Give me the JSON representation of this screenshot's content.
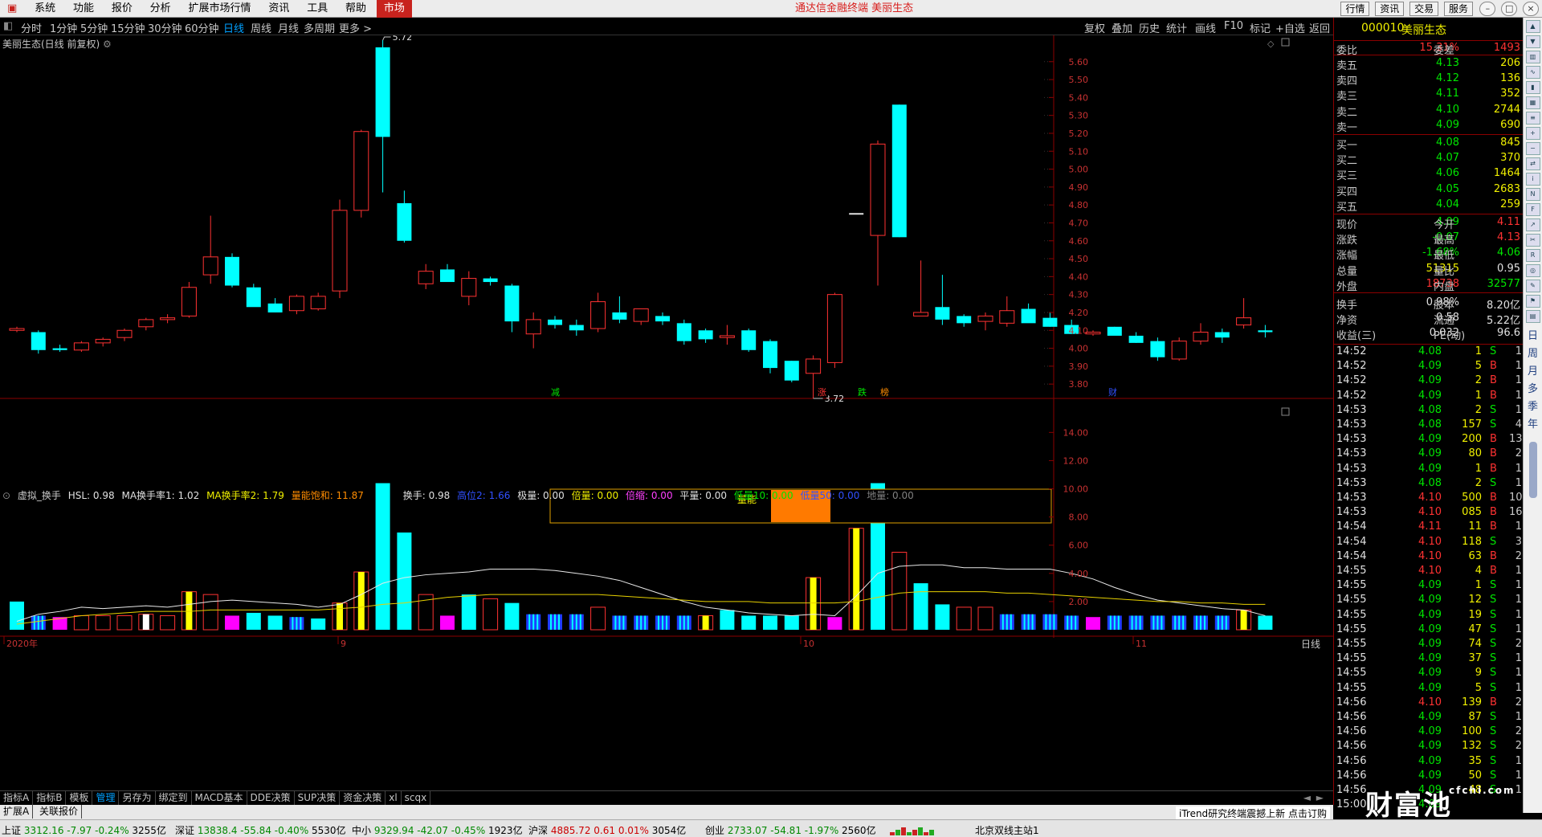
{
  "menu": [
    "系统",
    "功能",
    "报价",
    "分析",
    "扩展市场行情",
    "资讯",
    "工具",
    "帮助",
    "市场"
  ],
  "app_title": "通达信金融终端  美丽生态",
  "right_buttons": [
    "行情",
    "资讯",
    "交易",
    "服务"
  ],
  "periods": [
    "分时",
    "1分钟",
    "5分钟",
    "15分钟",
    "30分钟",
    "60分钟",
    "日线",
    "周线",
    "月线",
    "多周期",
    "更多 >"
  ],
  "active_period": "日线",
  "toolbar": [
    "复权",
    "叠加",
    "历史",
    "统计",
    "画线",
    "F10",
    "标记",
    "+自选",
    "返回"
  ],
  "chart_title": "美丽生态(日线 前复权)",
  "price_axis": [
    "5.60",
    "5.50",
    "5.40",
    "5.30",
    "5.20",
    "5.10",
    "5.00",
    "4.90",
    "4.80",
    "4.70",
    "4.60",
    "4.50",
    "4.40",
    "4.30",
    "4.20",
    "4.10",
    "4.00",
    "3.90",
    "3.80"
  ],
  "price_annotations": {
    "high": "5.72",
    "low": "3.72"
  },
  "event_markers": [
    "减",
    "涨",
    "跌",
    "榜",
    "财"
  ],
  "indicator": {
    "name": "虚拟_换手",
    "hsl": "HSL: 0.98",
    "ma1": "MA换手率1: 1.02",
    "ma2": "MA换手率2: 1.79",
    "saturation": "量能饱和: 11.87",
    "hs": "换手: 0.98",
    "gaodi2": "高位2: 1.66",
    "jiliang": "极量: 0.00",
    "beiliang": "倍量: 0.00",
    "beisuo": "倍缩: 0.00",
    "pingliang": "平量: 0.00",
    "diliang10": "低量10: 0.00",
    "diliang50": "低量50: 0.00",
    "diliang": "地量: 0.00"
  },
  "volume_axis": [
    "14.00",
    "12.00",
    "10.00",
    "8.00",
    "6.00",
    "4.00",
    "2.00"
  ],
  "volume_box_label": "量能",
  "date_labels": [
    "2020年",
    "9",
    "10",
    "11"
  ],
  "period_label": "日线",
  "quote": {
    "code": "000010",
    "name": "美丽生态",
    "weibi_label": "委比",
    "weibi": "15.31%",
    "weicha_label": "委差",
    "weicha": "1493",
    "asks": [
      {
        "label": "卖五",
        "price": "4.13",
        "vol": "206"
      },
      {
        "label": "卖四",
        "price": "4.12",
        "vol": "136"
      },
      {
        "label": "卖三",
        "price": "4.11",
        "vol": "352"
      },
      {
        "label": "卖二",
        "price": "4.10",
        "vol": "2744"
      },
      {
        "label": "卖一",
        "price": "4.09",
        "vol": "690"
      }
    ],
    "bids": [
      {
        "label": "买一",
        "price": "4.08",
        "vol": "845"
      },
      {
        "label": "买二",
        "price": "4.07",
        "vol": "370"
      },
      {
        "label": "买三",
        "price": "4.06",
        "vol": "1464"
      },
      {
        "label": "买四",
        "price": "4.05",
        "vol": "2683"
      },
      {
        "label": "买五",
        "price": "4.04",
        "vol": "259"
      }
    ],
    "stats": [
      {
        "l1": "现价",
        "v1": "4.09",
        "l2": "今开",
        "v2": "4.11"
      },
      {
        "l1": "涨跌",
        "v1": "-0.07",
        "l2": "最高",
        "v2": "4.13"
      },
      {
        "l1": "涨幅",
        "v1": "-1.68%",
        "l2": "最低",
        "v2": "4.06"
      },
      {
        "l1": "总量",
        "v1": "51315",
        "l2": "量比",
        "v2": "0.95"
      },
      {
        "l1": "外盘",
        "v1": "18738",
        "l2": "内盘",
        "v2": "32577"
      },
      {
        "l1": "换手",
        "v1": "0.98%",
        "l2": "股本",
        "v2": "8.20亿"
      },
      {
        "l1": "净资",
        "v1": "0.58",
        "l2": "流通",
        "v2": "5.22亿"
      },
      {
        "l1": "收益(三)",
        "v1": "0.032",
        "l2": "PE(动)",
        "v2": "96.6"
      }
    ],
    "ticks": [
      [
        "14:52",
        "4.08",
        "1",
        "S",
        "1"
      ],
      [
        "14:52",
        "4.09",
        "5",
        "B",
        "1"
      ],
      [
        "14:52",
        "4.09",
        "2",
        "B",
        "1"
      ],
      [
        "14:52",
        "4.09",
        "1",
        "B",
        "1"
      ],
      [
        "14:53",
        "4.08",
        "2",
        "S",
        "1"
      ],
      [
        "14:53",
        "4.08",
        "157",
        "S",
        "4"
      ],
      [
        "14:53",
        "4.09",
        "200",
        "B",
        "13"
      ],
      [
        "14:53",
        "4.09",
        "80",
        "B",
        "2"
      ],
      [
        "14:53",
        "4.09",
        "1",
        "B",
        "1"
      ],
      [
        "14:53",
        "4.08",
        "2",
        "S",
        "1"
      ],
      [
        "14:53",
        "4.10",
        "500",
        "B",
        "10"
      ],
      [
        "14:53",
        "4.10",
        "085",
        "B",
        "16"
      ],
      [
        "14:54",
        "4.11",
        "11",
        "B",
        "1"
      ],
      [
        "14:54",
        "4.10",
        "118",
        "S",
        "3"
      ],
      [
        "14:54",
        "4.10",
        "63",
        "B",
        "2"
      ],
      [
        "14:55",
        "4.10",
        "4",
        "B",
        "1"
      ],
      [
        "14:55",
        "4.09",
        "1",
        "S",
        "1"
      ],
      [
        "14:55",
        "4.09",
        "12",
        "S",
        "1"
      ],
      [
        "14:55",
        "4.09",
        "19",
        "S",
        "1"
      ],
      [
        "14:55",
        "4.09",
        "47",
        "S",
        "1"
      ],
      [
        "14:55",
        "4.09",
        "74",
        "S",
        "2"
      ],
      [
        "14:55",
        "4.09",
        "37",
        "S",
        "1"
      ],
      [
        "14:55",
        "4.09",
        "9",
        "S",
        "1"
      ],
      [
        "14:55",
        "4.09",
        "5",
        "S",
        "1"
      ],
      [
        "14:56",
        "4.10",
        "139",
        "B",
        "2"
      ],
      [
        "14:56",
        "4.09",
        "87",
        "S",
        "1"
      ],
      [
        "14:56",
        "4.09",
        "100",
        "S",
        "2"
      ],
      [
        "14:56",
        "4.09",
        "132",
        "S",
        "2"
      ],
      [
        "14:56",
        "4.09",
        "35",
        "S",
        "1"
      ],
      [
        "14:56",
        "4.09",
        "50",
        "S",
        "1"
      ],
      [
        "14:56",
        "4.09",
        "48",
        "S",
        "1"
      ],
      [
        "15:00",
        "4.09",
        "",
        "",
        ""
      ]
    ]
  },
  "bottom_tabs": [
    "指标A",
    "指标B",
    "模板",
    "管理",
    "另存为",
    "绑定到",
    "MACD基本",
    "DDE决策",
    "SUP决策",
    "资金决策",
    "xl",
    "scqx"
  ],
  "bottom_tabs2": [
    "扩展A",
    "关联报价"
  ],
  "trend_note": "iTrend研究终端震撼上新 点击订购",
  "side_tools": [
    "日",
    "周",
    "月",
    "多",
    "季",
    "年"
  ],
  "status": [
    {
      "name": "上证",
      "price": "3312.16",
      "chg": "-7.97",
      "pct": "-0.24%",
      "amt": "3255亿"
    },
    {
      "name": "深证",
      "price": "13838.4",
      "chg": "-55.84",
      "pct": "-0.40%",
      "amt": "5530亿"
    },
    {
      "name": "中小",
      "price": "9329.94",
      "chg": "-42.07",
      "pct": "-0.45%",
      "amt": "1923亿"
    },
    {
      "name": "沪深",
      "price": "4885.72",
      "chg": "0.61",
      "pct": "0.01%",
      "amt": "3054亿"
    },
    {
      "name": "创业",
      "price": "2733.07",
      "chg": "-54.81",
      "pct": "-1.97%",
      "amt": "2560亿"
    }
  ],
  "server": "北京双线主站1",
  "watermark": "财富池",
  "watermark_url": "cfchi.com",
  "chart_data": {
    "type": "candlestick",
    "title": "美丽生态(日线 前复权)",
    "x_labels": [
      "2020年",
      "9",
      "10",
      "11"
    ],
    "ylim": [
      3.72,
      5.72
    ],
    "candles": [
      [
        4.1,
        4.12,
        4.09,
        4.11,
        "up"
      ],
      [
        4.09,
        4.1,
        3.97,
        3.99,
        "dn"
      ],
      [
        3.99,
        4.02,
        3.98,
        4.0,
        "dn"
      ],
      [
        3.99,
        4.04,
        3.98,
        4.03,
        "up"
      ],
      [
        4.03,
        4.06,
        4.01,
        4.05,
        "up"
      ],
      [
        4.06,
        4.11,
        4.04,
        4.1,
        "up"
      ],
      [
        4.12,
        4.17,
        4.1,
        4.16,
        "up"
      ],
      [
        4.16,
        4.19,
        4.14,
        4.17,
        "up"
      ],
      [
        4.18,
        4.37,
        4.17,
        4.34,
        "up"
      ],
      [
        4.41,
        4.74,
        4.36,
        4.51,
        "up"
      ],
      [
        4.51,
        4.53,
        4.34,
        4.35,
        "dn"
      ],
      [
        4.34,
        4.36,
        4.24,
        4.23,
        "dn"
      ],
      [
        4.25,
        4.28,
        4.2,
        4.2,
        "dn"
      ],
      [
        4.21,
        4.3,
        4.19,
        4.29,
        "up"
      ],
      [
        4.22,
        4.31,
        4.21,
        4.29,
        "up"
      ],
      [
        4.32,
        4.83,
        4.28,
        4.77,
        "up"
      ],
      [
        4.77,
        5.22,
        4.73,
        5.21,
        "up"
      ],
      [
        5.68,
        5.72,
        4.87,
        5.18,
        "dn"
      ],
      [
        4.81,
        4.88,
        4.59,
        4.6,
        "dn"
      ],
      [
        4.43,
        4.47,
        4.33,
        4.36,
        "up"
      ],
      [
        4.44,
        4.47,
        4.37,
        4.37,
        "dn"
      ],
      [
        4.39,
        4.43,
        4.24,
        4.29,
        "up"
      ],
      [
        4.39,
        4.4,
        4.35,
        4.37,
        "dn"
      ],
      [
        4.35,
        4.36,
        4.09,
        4.15,
        "dn"
      ],
      [
        4.16,
        4.2,
        4.0,
        4.08,
        "up"
      ],
      [
        4.16,
        4.18,
        4.11,
        4.13,
        "dn"
      ],
      [
        4.13,
        4.16,
        4.07,
        4.1,
        "dn"
      ],
      [
        4.11,
        4.31,
        4.09,
        4.26,
        "up"
      ],
      [
        4.2,
        4.29,
        4.14,
        4.16,
        "dn"
      ],
      [
        4.22,
        4.22,
        4.13,
        4.15,
        "up"
      ],
      [
        4.18,
        4.2,
        4.13,
        4.15,
        "dn"
      ],
      [
        4.14,
        4.16,
        4.02,
        4.04,
        "dn"
      ],
      [
        4.1,
        4.11,
        4.03,
        4.05,
        "dn"
      ],
      [
        4.07,
        4.13,
        4.02,
        4.06,
        "up"
      ],
      [
        4.1,
        4.11,
        3.98,
        3.99,
        "dn"
      ],
      [
        4.04,
        4.05,
        3.86,
        3.89,
        "dn"
      ],
      [
        3.93,
        3.93,
        3.81,
        3.82,
        "dn"
      ],
      [
        3.94,
        3.96,
        3.72,
        3.86,
        "up"
      ],
      [
        3.92,
        4.31,
        3.89,
        4.3,
        "up"
      ],
      [
        4.75,
        4.76,
        4.76,
        4.75,
        "flat"
      ],
      [
        4.63,
        5.16,
        4.35,
        5.14,
        "up"
      ],
      [
        5.36,
        5.36,
        4.62,
        4.62,
        "dn"
      ],
      [
        4.2,
        4.49,
        4.18,
        4.18,
        "up"
      ],
      [
        4.23,
        4.41,
        4.13,
        4.16,
        "dn"
      ],
      [
        4.18,
        4.19,
        4.12,
        4.14,
        "dn"
      ],
      [
        4.15,
        4.2,
        4.1,
        4.18,
        "up"
      ],
      [
        4.14,
        4.29,
        4.12,
        4.21,
        "up"
      ],
      [
        4.22,
        4.25,
        4.15,
        4.14,
        "dn"
      ],
      [
        4.17,
        4.2,
        4.12,
        4.12,
        "dn"
      ],
      [
        4.13,
        4.16,
        4.08,
        4.08,
        "dn"
      ],
      [
        4.08,
        4.1,
        4.07,
        4.09,
        "up"
      ],
      [
        4.12,
        4.12,
        4.08,
        4.07,
        "dn"
      ],
      [
        4.07,
        4.09,
        4.03,
        4.03,
        "dn"
      ],
      [
        4.04,
        4.06,
        3.93,
        3.95,
        "dn"
      ],
      [
        3.94,
        4.06,
        3.93,
        4.04,
        "up"
      ],
      [
        4.04,
        4.14,
        4.02,
        4.09,
        "up"
      ],
      [
        4.09,
        4.11,
        4.03,
        4.06,
        "dn"
      ],
      [
        4.13,
        4.28,
        4.11,
        4.17,
        "up"
      ],
      [
        4.1,
        4.13,
        4.06,
        4.09,
        "dn"
      ]
    ],
    "volume": {
      "ylabel": "",
      "ylim": [
        0,
        15
      ],
      "bars": [
        [
          2.0,
          "c"
        ],
        [
          1.0,
          "b"
        ],
        [
          0.9,
          "m"
        ],
        [
          1.0,
          "r"
        ],
        [
          1.0,
          "r"
        ],
        [
          1.0,
          "r"
        ],
        [
          1.1,
          "w"
        ],
        [
          1.0,
          "r"
        ],
        [
          2.7,
          "y"
        ],
        [
          2.5,
          "r"
        ],
        [
          1.0,
          "m"
        ],
        [
          1.2,
          "c"
        ],
        [
          1.0,
          "c"
        ],
        [
          0.9,
          "b"
        ],
        [
          0.8,
          "c"
        ],
        [
          1.9,
          "y"
        ],
        [
          4.1,
          "y"
        ],
        [
          10.4,
          "c"
        ],
        [
          6.9,
          "c"
        ],
        [
          2.5,
          "r"
        ],
        [
          1.0,
          "m"
        ],
        [
          2.5,
          "c"
        ],
        [
          2.2,
          "r"
        ],
        [
          1.9,
          "c"
        ],
        [
          1.1,
          "b"
        ],
        [
          1.1,
          "b"
        ],
        [
          1.1,
          "b"
        ],
        [
          1.6,
          "r"
        ],
        [
          1.0,
          "b"
        ],
        [
          1.0,
          "b"
        ],
        [
          1.0,
          "b"
        ],
        [
          1.0,
          "b"
        ],
        [
          1.0,
          "y"
        ],
        [
          1.4,
          "c"
        ],
        [
          1.0,
          "c"
        ],
        [
          1.0,
          "c"
        ],
        [
          1.0,
          "c"
        ],
        [
          3.7,
          "y"
        ],
        [
          0.9,
          "m"
        ],
        [
          7.2,
          "y"
        ],
        [
          10.4,
          "c"
        ],
        [
          5.5,
          "r"
        ],
        [
          3.3,
          "c"
        ],
        [
          1.8,
          "c"
        ],
        [
          1.6,
          "r"
        ],
        [
          1.6,
          "r"
        ],
        [
          1.1,
          "b"
        ],
        [
          1.1,
          "b"
        ],
        [
          1.1,
          "b"
        ],
        [
          1.0,
          "b"
        ],
        [
          0.9,
          "m"
        ],
        [
          1.0,
          "b"
        ],
        [
          1.0,
          "b"
        ],
        [
          1.0,
          "b"
        ],
        [
          1.0,
          "b"
        ],
        [
          1.0,
          "b"
        ],
        [
          1.0,
          "b"
        ],
        [
          1.4,
          "y"
        ],
        [
          1.0,
          "c"
        ]
      ],
      "ma1": [
        0.6,
        1.1,
        1.3,
        1.6,
        1.5,
        1.6,
        1.7,
        1.6,
        1.8,
        2.0,
        2.1,
        2.0,
        1.9,
        1.8,
        1.6,
        1.8,
        2.5,
        3.3,
        3.7,
        3.9,
        4.0,
        4.1,
        4.3,
        4.3,
        4.3,
        4.2,
        4.0,
        3.8,
        3.5,
        3.0,
        2.5,
        2.0,
        1.6,
        1.4,
        1.2,
        1.1,
        1.0,
        1.1,
        1.0,
        2.4,
        4.0,
        4.5,
        4.6,
        4.6,
        4.4,
        4.4,
        4.3,
        4.3,
        4.3,
        4.0,
        3.6,
        3.0,
        2.5,
        2.1,
        1.9,
        1.7,
        1.5,
        1.4,
        1.0
      ],
      "ma2": [
        0.4,
        0.6,
        0.8,
        1.0,
        1.1,
        1.2,
        1.3,
        1.3,
        1.3,
        1.4,
        1.4,
        1.4,
        1.4,
        1.4,
        1.4,
        1.5,
        1.6,
        1.8,
        1.9,
        2.1,
        2.3,
        2.4,
        2.5,
        2.5,
        2.5,
        2.5,
        2.5,
        2.5,
        2.4,
        2.3,
        2.2,
        2.1,
        2.0,
        2.0,
        2.0,
        1.9,
        1.9,
        1.9,
        1.9,
        2.0,
        2.3,
        2.6,
        2.7,
        2.7,
        2.7,
        2.7,
        2.6,
        2.6,
        2.5,
        2.4,
        2.3,
        2.2,
        2.1,
        2.0,
        2.0,
        1.9,
        1.9,
        1.8,
        1.8
      ]
    }
  }
}
